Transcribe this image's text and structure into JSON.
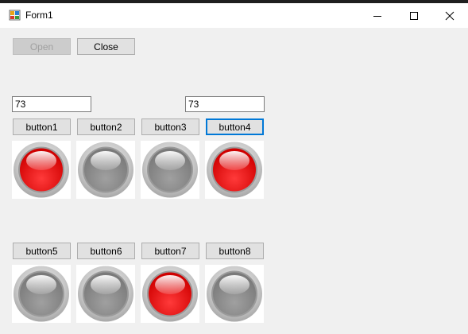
{
  "window": {
    "title": "Form1",
    "icon": "winforms-app-icon",
    "controls": [
      "minimize-icon",
      "maximize-icon",
      "close-icon"
    ]
  },
  "buttons": {
    "open": "Open",
    "close": "Close"
  },
  "textboxes": {
    "left": "73",
    "right": "73"
  },
  "row1": [
    {
      "label": "button1",
      "lamp": "on"
    },
    {
      "label": "button2",
      "lamp": "off"
    },
    {
      "label": "button3",
      "lamp": "off"
    },
    {
      "label": "button4",
      "lamp": "on"
    }
  ],
  "row2": [
    {
      "label": "button5",
      "lamp": "off"
    },
    {
      "label": "button6",
      "lamp": "off"
    },
    {
      "label": "button7",
      "lamp": "on"
    },
    {
      "label": "button8",
      "lamp": "off"
    }
  ],
  "colors": {
    "lamp_on": "#ff0000",
    "lamp_off": "#8c8c8c",
    "focus_border": "#0078d7"
  }
}
